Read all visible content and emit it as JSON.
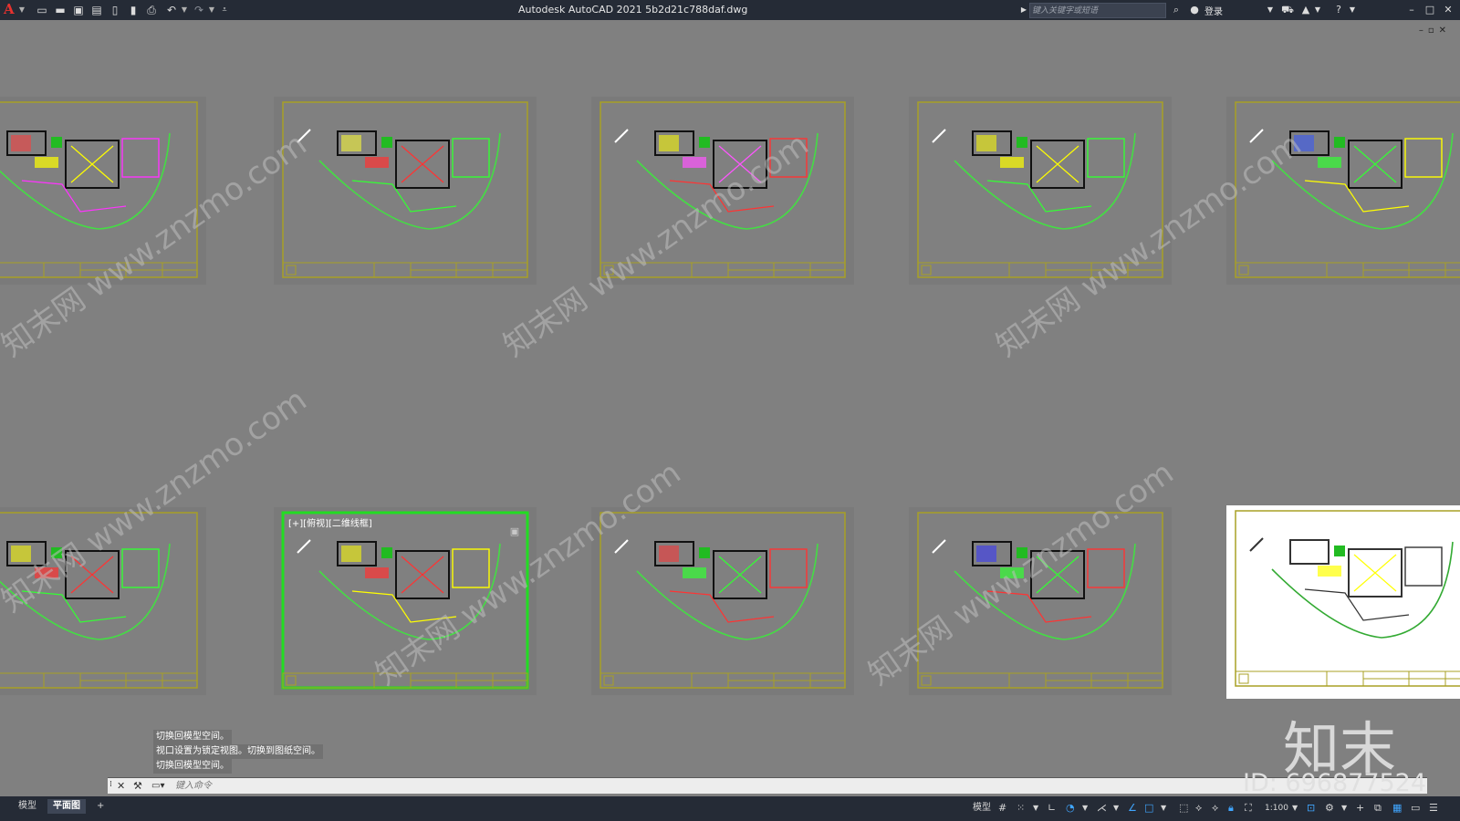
{
  "titlebar": {
    "app_title": "Autodesk AutoCAD 2021    5b2d21c788daf.dwg",
    "search_placeholder": "键入关键字或短语",
    "login_label": "登录",
    "app_icon": "autocad-a-icon",
    "quick_access": [
      "new-icon",
      "open-icon",
      "save-icon",
      "saveas-icon",
      "publish-icon",
      "plot-preview-icon",
      "print-icon",
      "undo-icon",
      "redo-icon",
      "customize-icon"
    ]
  },
  "drawing": {
    "viewport_label": "[+][俯视][二维线框]",
    "sheets_row1": 5,
    "sheets_row2": 5
  },
  "command": {
    "history": [
      "切换回模型空间。",
      "视口设置为锁定视图。切换到图纸空间。",
      "切换回模型空间。"
    ],
    "placeholder": "键入命令"
  },
  "status": {
    "tabs": [
      "模型",
      "平面图"
    ],
    "add_tab": "+",
    "model_label": "模型",
    "scale": "1:100"
  },
  "watermark": {
    "text": "知末网 www.znzmo.com",
    "brand": "知末",
    "id": "ID: 696877524"
  },
  "colors": {
    "background": "#808080",
    "frame": "#a8a025",
    "active_frame": "#22dd22",
    "wall": "#111111",
    "plan_outline": "#44dd44"
  }
}
